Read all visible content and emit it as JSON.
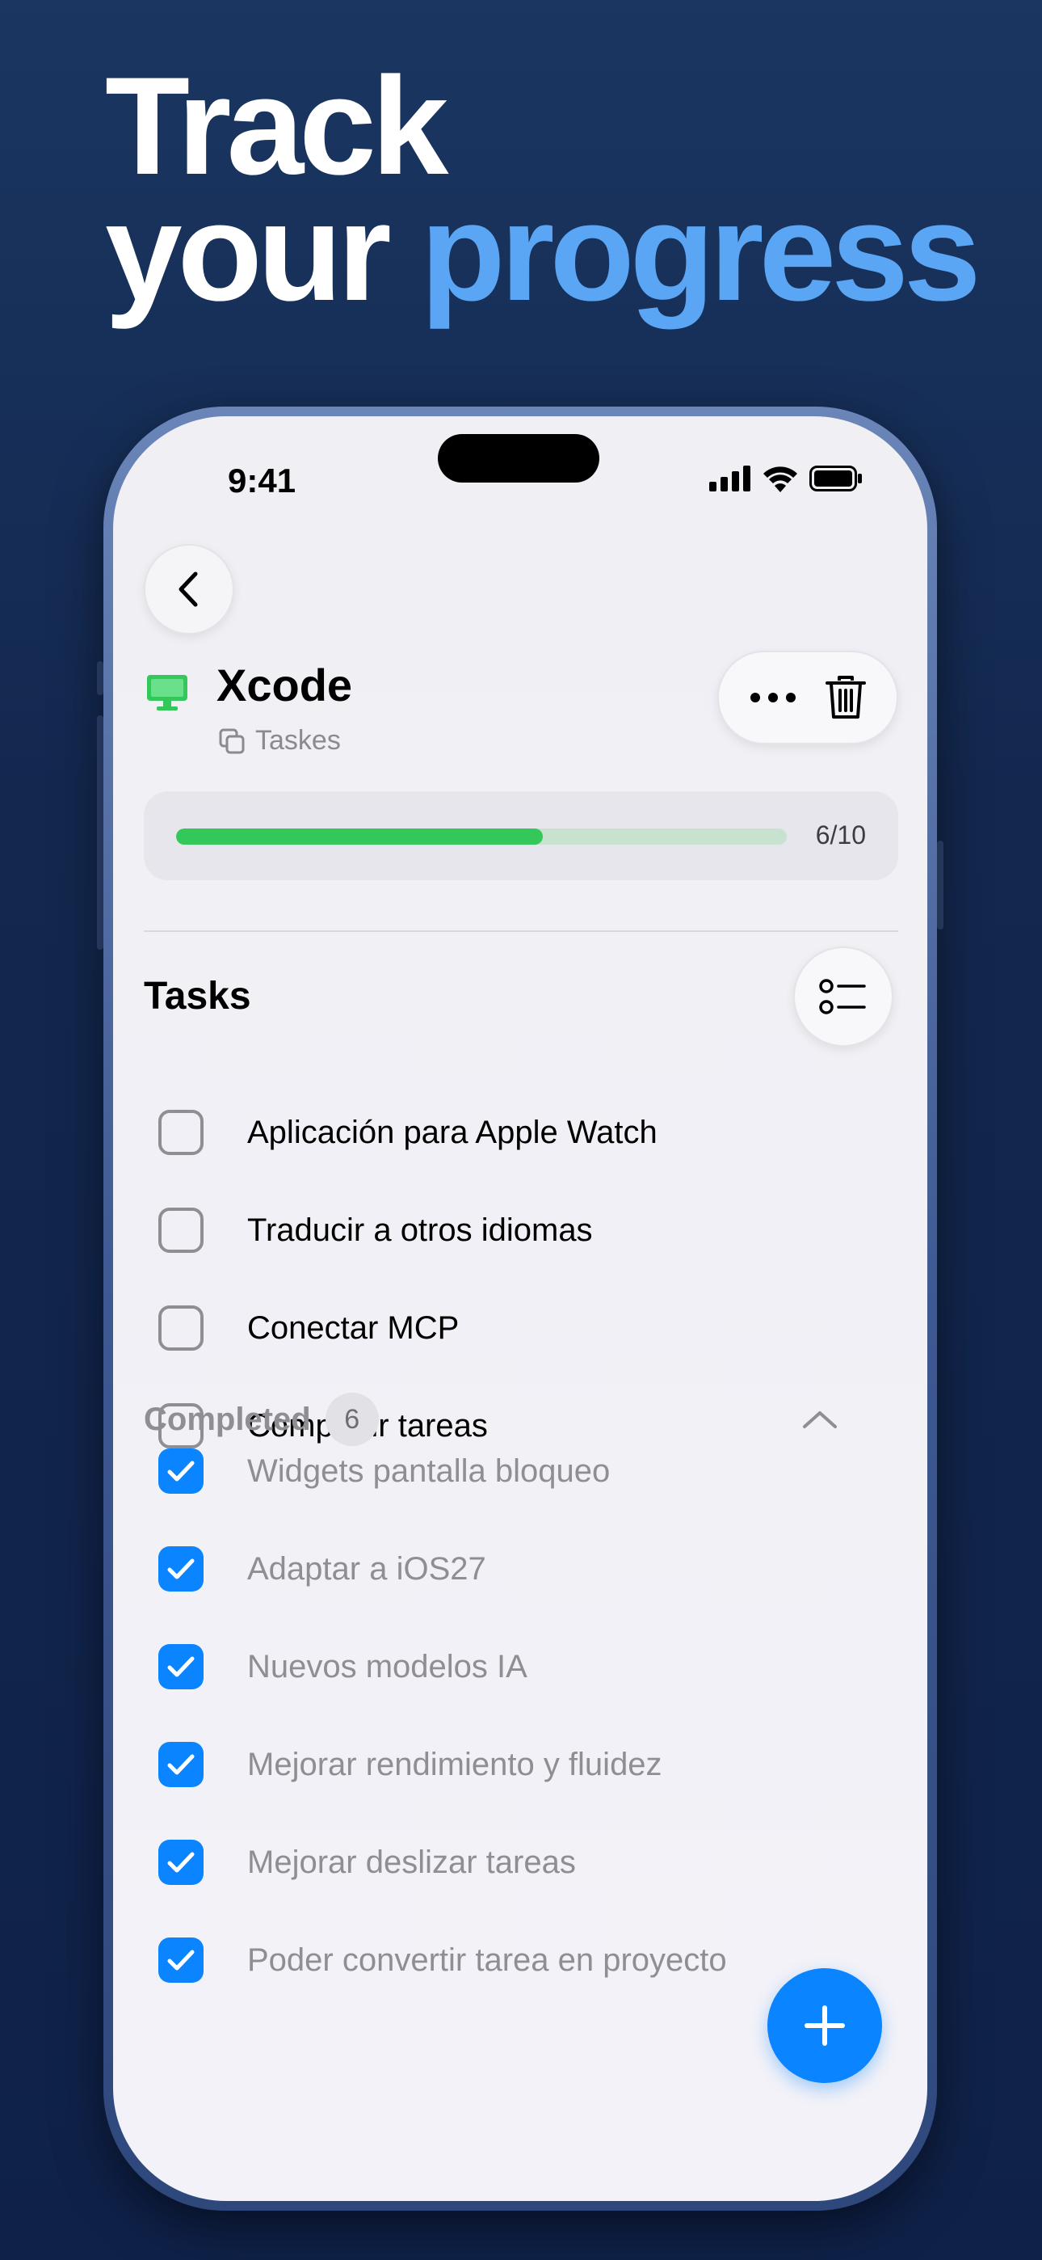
{
  "headline": {
    "line1": "Track",
    "line2_plain": "your",
    "line2_accent": "progress"
  },
  "status_bar": {
    "time": "9:41"
  },
  "project": {
    "title": "Xcode",
    "subtitle": "Taskes"
  },
  "progress": {
    "label": "6/10",
    "completed": 6,
    "total": 10
  },
  "tasks_section": {
    "title": "Tasks",
    "items": [
      {
        "label": "Aplicación para Apple Watch",
        "done": false
      },
      {
        "label": "Traducir a otros idiomas",
        "done": false
      },
      {
        "label": "Conectar MCP",
        "done": false
      },
      {
        "label": "Compartir tareas",
        "done": false
      }
    ]
  },
  "completed_section": {
    "label": "Completed",
    "count": "6",
    "items": [
      {
        "label": "Widgets pantalla bloqueo",
        "done": true
      },
      {
        "label": "Adaptar a iOS27",
        "done": true
      },
      {
        "label": "Nuevos modelos IA",
        "done": true
      },
      {
        "label": "Mejorar rendimiento y fluidez",
        "done": true
      },
      {
        "label": "Mejorar deslizar tareas",
        "done": true
      },
      {
        "label": "Poder convertir tarea en proyecto",
        "done": true
      }
    ]
  },
  "colors": {
    "accent": "#0a84ff",
    "progress": "#34c759",
    "headline_accent": "#5aa6f5"
  },
  "icons": {
    "back": "chevron-left-icon",
    "more": "ellipsis-icon",
    "delete": "trash-icon",
    "project": "desktop-icon",
    "list_style": "checklist-icon",
    "collapse": "chevron-up-icon",
    "add": "plus-icon"
  }
}
